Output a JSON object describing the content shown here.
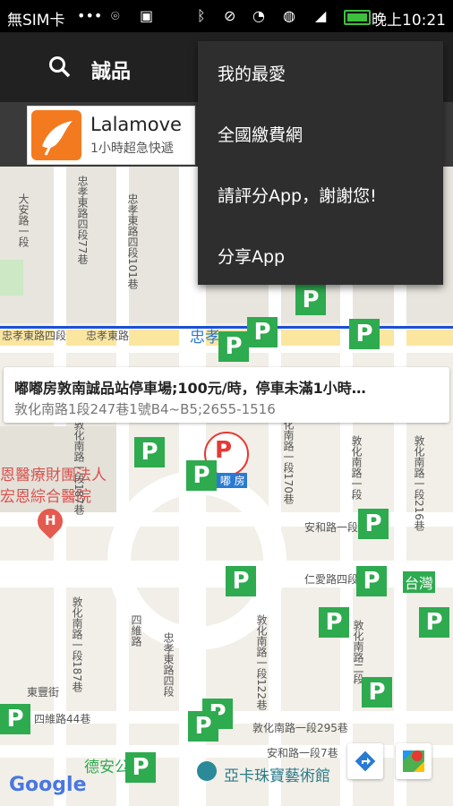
{
  "status_bar": {
    "carrier": "無SIM卡",
    "dots": "•••",
    "time": "晚上10:21"
  },
  "toolbar": {
    "title": "誠品"
  },
  "ad": {
    "title": "Lalamove",
    "subtitle": "1小時超急快遞"
  },
  "menu": {
    "items": [
      {
        "label": "我的最愛"
      },
      {
        "label": "全國繳費網"
      },
      {
        "label": "請評分App，謝謝您!"
      },
      {
        "label": "分享App"
      }
    ]
  },
  "info_window": {
    "name": "嘟嘟房敦南誠品站停車場;100元/時，停車未滿1小時…",
    "address": "敦化南路1段247巷1號B4~B5;2655-1516"
  },
  "map": {
    "parking_glyph": "P",
    "marker_label": "嘟 嘟 房",
    "streets": {
      "zhongxiao_w": "忠孝東路四段",
      "zhongxiao_w2": "忠孝東路",
      "zhongxiao_big": "忠孝",
      "anhe_1": "安和路一段",
      "anhe_2": "安和路一段7巷",
      "renai": "仁愛路四段",
      "dunhua_295": "敦化南路一段295巷",
      "dongfeng": "東豐街",
      "siwei": "四維路44巷",
      "hospital_1": "恩醫療財團法人",
      "hospital_2": "宏恩綜合醫院",
      "museum": "亞卡珠寶藝術館",
      "deanpark": "德安公",
      "taiwan": "台灣",
      "v_dunhua_s": "敦化南路一段",
      "v_zx_101": "忠孝東路四段101巷",
      "v_zx_77": "忠孝東路四段77巷",
      "v_daan": "大安路一段",
      "v_dunhua_170": "敦化南路一段170巷",
      "v_dunhua_187": "敦化南路一段187巷",
      "v_dunhua_122": "敦化南路一段122巷",
      "v_dunhua_216": "敦化南路一段216巷",
      "v_siwei": "四維路",
      "v_zx_route": "忠孝東路四段",
      "v_dunhua_s2": "敦化南路二段"
    }
  },
  "google_logo": "Google",
  "colors": {
    "accent_parking": "#2eaa4f",
    "route_blue": "#1a4fd6",
    "toolbar": "#212121"
  },
  "icons": {
    "search": "search-icon",
    "directions": "directions-icon",
    "maps": "google-maps-icon"
  }
}
